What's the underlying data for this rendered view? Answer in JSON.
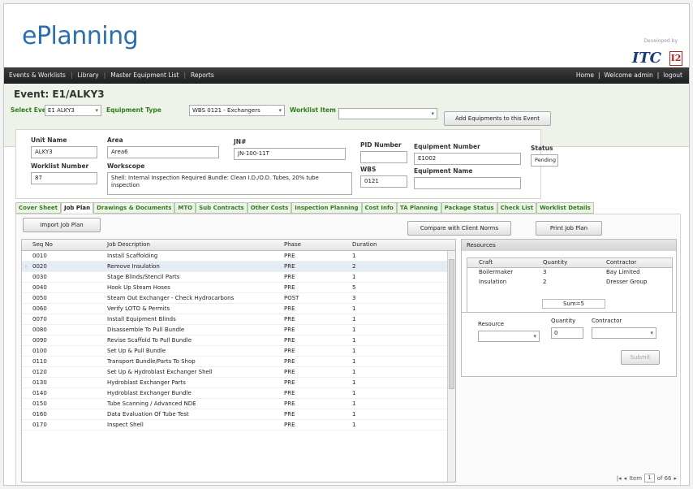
{
  "app": {
    "title": "ePlanning",
    "developed_by": "Developed by",
    "vendor": "ITC",
    "vendor_mark": "I2"
  },
  "nav": {
    "items": [
      "Events & Worklists",
      "Library",
      "Master Equipment List",
      "Reports"
    ],
    "right": {
      "home": "Home",
      "welcome": "Welcome admin",
      "logout": "logout"
    }
  },
  "event": {
    "title": "Event: E1/ALKY3",
    "select_event_label": "Select Event",
    "select_event_value": "E1 ALKY3",
    "equipment_type_label": "Equipment Type",
    "equipment_type_value": "WBS 0121 - Exchangers",
    "worklist_item_label": "Worklist Item",
    "worklist_item_value": "",
    "add_button": "Add Equipments to this Event"
  },
  "info": {
    "unit_name_label": "Unit Name",
    "unit_name": "ALKY3",
    "area_label": "Area",
    "area": "Area6",
    "jn_label": "JN#",
    "jn": "JN-100-11T",
    "pid_label": "PID Number",
    "pid": "",
    "equipment_number_label": "Equipment Number",
    "equipment_number": "E1002",
    "status_label": "Status",
    "status": "Pending",
    "worklist_number_label": "Worklist Number",
    "worklist_number": "87",
    "workscope_label": "Workscope",
    "workscope": "Shell:  Internal Inspection Required  Bundle: Clean I.D./O.D. Tubes, 20% tube inspection",
    "wbs_label": "WBS",
    "wbs": "0121",
    "equipment_name_label": "Equipment Name",
    "equipment_name": ""
  },
  "tabs": [
    "Cover Sheet",
    "Job Plan",
    "Drawings & Documents",
    "MTO",
    "Sub Contracts",
    "Other Costs",
    "Inspection Planning",
    "Cost Info",
    "TA Planning",
    "Package Status",
    "Check List",
    "Worklist Details"
  ],
  "active_tab": "Job Plan",
  "actions": {
    "import": "Import Job Plan",
    "compare": "Compare with Client Norms",
    "print": "Print Job Plan"
  },
  "jobplan": {
    "columns": [
      "Seq No",
      "Job Description",
      "Phase",
      "Duration"
    ],
    "rows": [
      [
        "0010",
        "Install Scaffolding",
        "PRE",
        "1"
      ],
      [
        "0020",
        "Remove Insulation",
        "PRE",
        "2"
      ],
      [
        "0030",
        "Stage Blinds/Stencil Parts",
        "PRE",
        "1"
      ],
      [
        "0040",
        "Hook Up Steam Hoses",
        "PRE",
        "5"
      ],
      [
        "0050",
        "Steam Out Exchanger - Check Hydrocarbons",
        "POST",
        "3"
      ],
      [
        "0060",
        "Verify LOTO & Permits",
        "PRE",
        "1"
      ],
      [
        "0070",
        "Install Equipment Blinds",
        "PRE",
        "1"
      ],
      [
        "0080",
        "Disassemble To Pull Bundle",
        "PRE",
        "1"
      ],
      [
        "0090",
        "Revise Scaffold To Pull Bundle",
        "PRE",
        "1"
      ],
      [
        "0100",
        "Set Up & Pull Bundle",
        "PRE",
        "1"
      ],
      [
        "0110",
        "Transport Bundle/Parts To Shop",
        "PRE",
        "1"
      ],
      [
        "0120",
        "Set Up & Hydroblast Exchanger Shell",
        "PRE",
        "1"
      ],
      [
        "0130",
        "Hydroblast Exchanger Parts",
        "PRE",
        "1"
      ],
      [
        "0140",
        "Hydroblast Exchanger Bundle",
        "PRE",
        "1"
      ],
      [
        "0150",
        "Tube Scanning / Advanced NDE",
        "PRE",
        "1"
      ],
      [
        "0160",
        "Data Evaluation Of Tube Test",
        "PRE",
        "1"
      ],
      [
        "0170",
        "Inspect Shell",
        "PRE",
        "1"
      ]
    ]
  },
  "resources": {
    "title": "Resources",
    "columns": [
      "Craft",
      "Quantity",
      "Contractor"
    ],
    "rows": [
      [
        "Boilermaker",
        "3",
        "Bay Limited"
      ],
      [
        "Insulation",
        "2",
        "Dresser Group"
      ]
    ],
    "sum": "Sum=5",
    "form": {
      "resource_label": "Resource",
      "quantity_label": "Quantity",
      "quantity_value": "0",
      "contractor_label": "Contractor",
      "submit": "Submit"
    }
  },
  "pager": {
    "item_label": "Item",
    "item_value": "1",
    "of_label": "of 66"
  }
}
